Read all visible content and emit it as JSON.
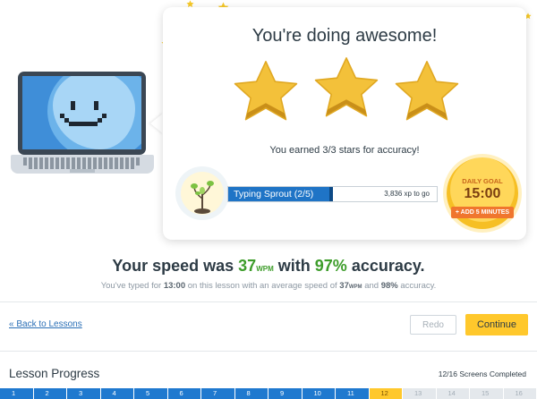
{
  "card": {
    "title": "You're doing awesome!",
    "stars_earned": 3,
    "stars_total": 3,
    "subtitle": "You earned 3/3 stars for accuracy!"
  },
  "xp": {
    "level_label": "Typing Sprout (2/5)",
    "remaining": "3,836 xp to go",
    "progress": 0.5
  },
  "daily_goal": {
    "title": "DAILY GOAL",
    "time": "15:00",
    "button": "+ ADD 5 MINUTES"
  },
  "speed": {
    "prefix": "Your speed was",
    "wpm": "37",
    "unit": "WPM",
    "middle": "with",
    "accuracy": "97%",
    "suffix": "accuracy."
  },
  "speed_sub": {
    "p1": "You've typed for",
    "time": "13:00",
    "p2": "on this lesson with an average speed of",
    "wpm": "37",
    "unit": "WPM",
    "p3": "and",
    "accuracy": "98%",
    "p4": "accuracy."
  },
  "nav": {
    "back": "« Back to Lessons",
    "redo": "Redo",
    "continue": "Continue"
  },
  "lesson_progress": {
    "title": "Lesson Progress",
    "completed_text": "12/16 Screens Completed",
    "current": 12,
    "cells": [
      "1",
      "2",
      "3",
      "4",
      "5",
      "6",
      "7",
      "8",
      "9",
      "10",
      "11",
      "12",
      "13",
      "14",
      "15",
      "16"
    ]
  },
  "colors": {
    "accent_yellow": "#ffc82c",
    "progress_blue": "#1f79cf",
    "green": "#3e9d2b"
  }
}
